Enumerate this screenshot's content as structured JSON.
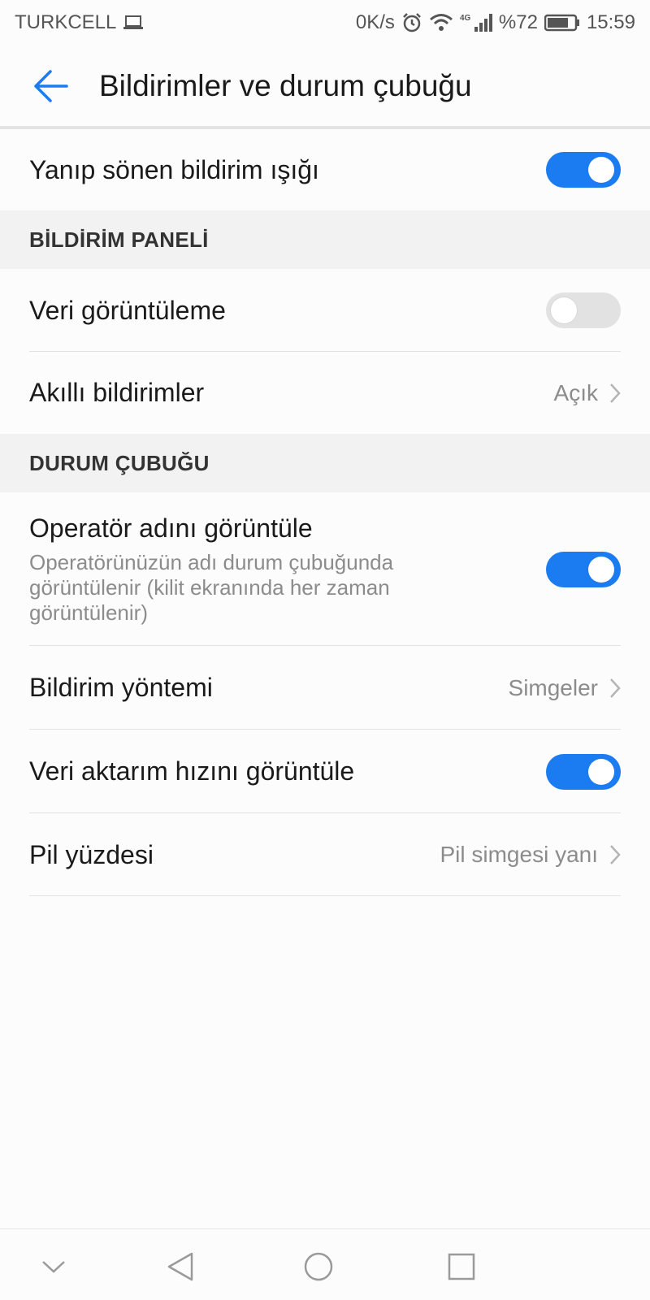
{
  "status_bar": {
    "carrier": "TURKCELL",
    "speed": "0K/s",
    "network": "4G",
    "battery": "%72",
    "time": "15:59"
  },
  "header": {
    "title": "Bildirimler ve durum çubuğu"
  },
  "rows": {
    "blinking_light": {
      "label": "Yanıp sönen bildirim ışığı",
      "on": true
    }
  },
  "sections": {
    "notification_panel": {
      "header": "BİLDİRİM PANELİ",
      "data_display": {
        "label": "Veri görüntüleme",
        "on": false
      },
      "smart_notifications": {
        "label": "Akıllı bildirimler",
        "value": "Açık"
      }
    },
    "status_bar": {
      "header": "DURUM ÇUBUĞU",
      "operator_name": {
        "label": "Operatör adını görüntüle",
        "description": "Operatörünüzün adı durum çubuğunda görüntülenir (kilit ekranında her zaman görüntülenir)",
        "on": true
      },
      "notification_method": {
        "label": "Bildirim yöntemi",
        "value": "Simgeler"
      },
      "data_speed": {
        "label": "Veri aktarım hızını görüntüle",
        "on": true
      },
      "battery_percent": {
        "label": "Pil yüzdesi",
        "value": "Pil simgesi yanı"
      }
    }
  },
  "colors": {
    "accent": "#1a7cf0",
    "toggle_off": "#e2e2e2"
  }
}
